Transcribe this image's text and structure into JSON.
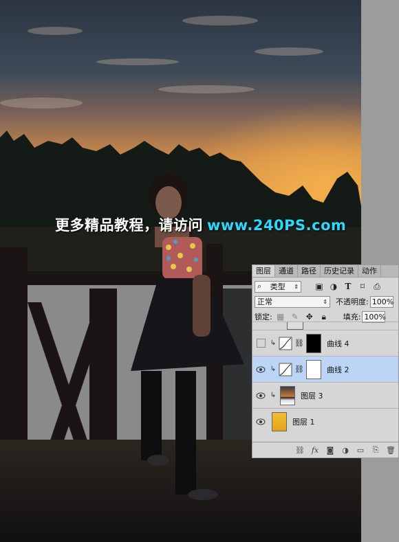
{
  "watermark": {
    "text_cn": "更多精品教程，请访问",
    "text_url": "www.240PS.com"
  },
  "layers_panel": {
    "tabs": [
      "图层",
      "通道",
      "路径",
      "历史记录",
      "动作"
    ],
    "active_tab": 0,
    "filter_kind_label": "类型",
    "blend_mode": "正常",
    "opacity_label": "不透明度:",
    "opacity_value": "100%",
    "lock_label": "锁定:",
    "fill_label": "填充:",
    "fill_value": "100%",
    "layers": [
      {
        "name": "曲线 4",
        "visible": false,
        "selected": false,
        "type": "curves",
        "mask": "black"
      },
      {
        "name": "曲线 2",
        "visible": true,
        "selected": true,
        "type": "curves",
        "mask": "white"
      },
      {
        "name": "图层 3",
        "visible": true,
        "selected": false,
        "type": "image"
      },
      {
        "name": "图层 1",
        "visible": true,
        "selected": false,
        "type": "image"
      }
    ],
    "bottom_icons": [
      "link-icon",
      "fx-icon",
      "mask-icon",
      "adjustment-icon",
      "folder-icon",
      "new-layer-icon",
      "trash-icon"
    ],
    "fx_label": "fx"
  },
  "colors": {
    "selected_row": "#bcd5f6",
    "url_text": "#29d9ff",
    "panel_bg": "#d6d6d6"
  }
}
